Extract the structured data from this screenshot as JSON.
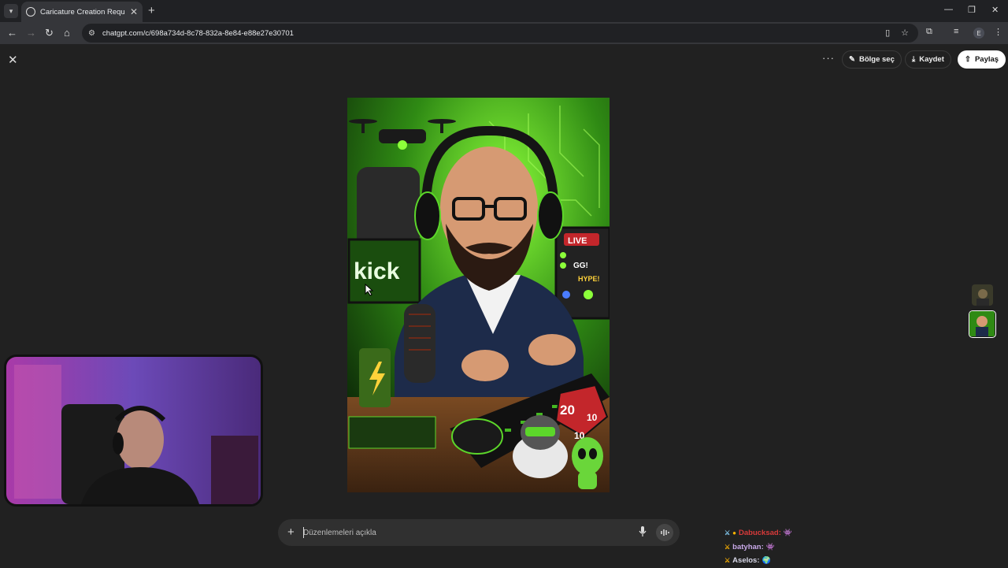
{
  "browser": {
    "tab_title": "Caricature Creation Request",
    "url": "chatgpt.com/c/698a734d-8c78-832a-8e84-e88e27e30701",
    "profile_initial": "E"
  },
  "viewer": {
    "region_select_label": "Bölge seç",
    "save_label": "Kaydet",
    "share_label": "Paylaş"
  },
  "image_text": {
    "kick": "kick",
    "live": "LIVE",
    "gg": "GG!",
    "hype": "HYPE!",
    "dice_20": "20",
    "dice_10a": "10",
    "dice_10b": "10"
  },
  "composer": {
    "placeholder": "Düzenlemeleri açıkla"
  },
  "stream_chat": [
    {
      "user": "Dabucksad:",
      "color": "#d83a3a"
    },
    {
      "user": "batyhan:",
      "color": "#c8a9e8"
    },
    {
      "user": "Aselos:",
      "color": "#d8d8e8"
    }
  ]
}
